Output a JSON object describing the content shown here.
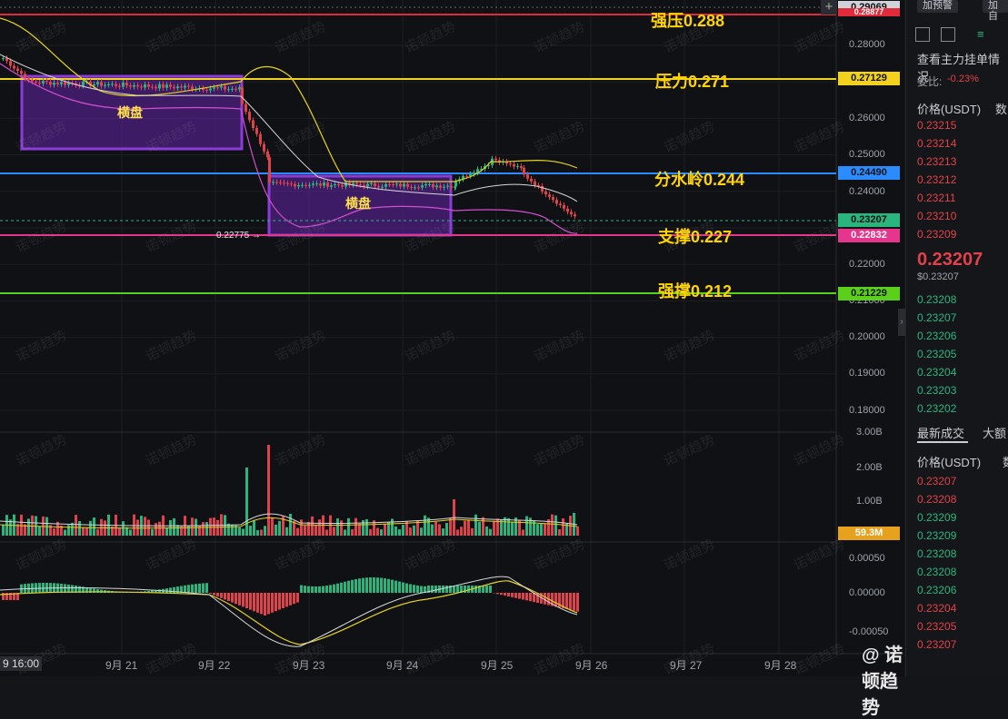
{
  "chart": {
    "price_axis": [
      "0.28000",
      "0.27000",
      "0.26000",
      "0.25000",
      "0.24000",
      "0.23000",
      "0.22000",
      "0.21000",
      "0.20000",
      "0.19000",
      "0.18000"
    ],
    "volume_axis": [
      "3.00B",
      "2.00B",
      "1.00B"
    ],
    "macd_axis": [
      "0.00050",
      "0.00000",
      "-0.00050"
    ],
    "dates": [
      "9 16:00",
      "9月 21",
      "9月 22",
      "9月 23",
      "9月 24",
      "9月 25",
      "9月 26",
      "9月 27",
      "9月 28"
    ],
    "pills": {
      "top": "0.29069",
      "strong_resist": "0.28877",
      "resist": "0.27129",
      "watershed": "0.24490",
      "last": "0.23207",
      "support": "0.22832",
      "strong_support": "0.21229",
      "volume": "59.3M"
    },
    "levels": {
      "strong_resist": "强压0.288",
      "resist": "压力0.271",
      "watershed": "分水岭0.244",
      "support": "支撑0.227",
      "strong_support": "强撑0.212"
    },
    "boxes": {
      "left": "横盘",
      "right": "横盘"
    },
    "low_marker": "0.22775 →",
    "watermark": "诺顿趋势",
    "brand": "@ 诺顿趋势",
    "colors": {
      "strong_resist": "#e02b3a",
      "resist": "#f2d21c",
      "watershed": "#2b8cff",
      "support": "#e5358c",
      "strong_support": "#5bd01a",
      "last": "#2bb57e",
      "box": "#8a3dd6"
    }
  },
  "panel": {
    "top_buttons": [
      "加预警",
      "加自"
    ],
    "depth_title": "查看主力挂单情况",
    "ratio_label": "委比:",
    "ratio_value": "-0.23%",
    "price_header": "价格(USDT)",
    "qty_header": "数",
    "asks": [
      "0.23215",
      "0.23214",
      "0.23213",
      "0.23212",
      "0.23211",
      "0.23210",
      "0.23209"
    ],
    "last_price": "0.23207",
    "last_price_usd": "$0.23207",
    "bids": [
      "0.23208",
      "0.23207",
      "0.23206",
      "0.23205",
      "0.23204",
      "0.23203",
      "0.23202"
    ],
    "tabs": [
      "最新成交",
      "大额"
    ],
    "trades_header": "价格(USDT)",
    "trades_qty": "数",
    "trades": [
      {
        "p": "0.23207",
        "side": "red"
      },
      {
        "p": "0.23208",
        "side": "red"
      },
      {
        "p": "0.23209",
        "side": "green"
      },
      {
        "p": "0.23209",
        "side": "green"
      },
      {
        "p": "0.23208",
        "side": "green"
      },
      {
        "p": "0.23208",
        "side": "green"
      },
      {
        "p": "0.23206",
        "side": "green"
      },
      {
        "p": "0.23204",
        "side": "red"
      },
      {
        "p": "0.23205",
        "side": "red"
      },
      {
        "p": "0.23207",
        "side": "red"
      }
    ]
  }
}
